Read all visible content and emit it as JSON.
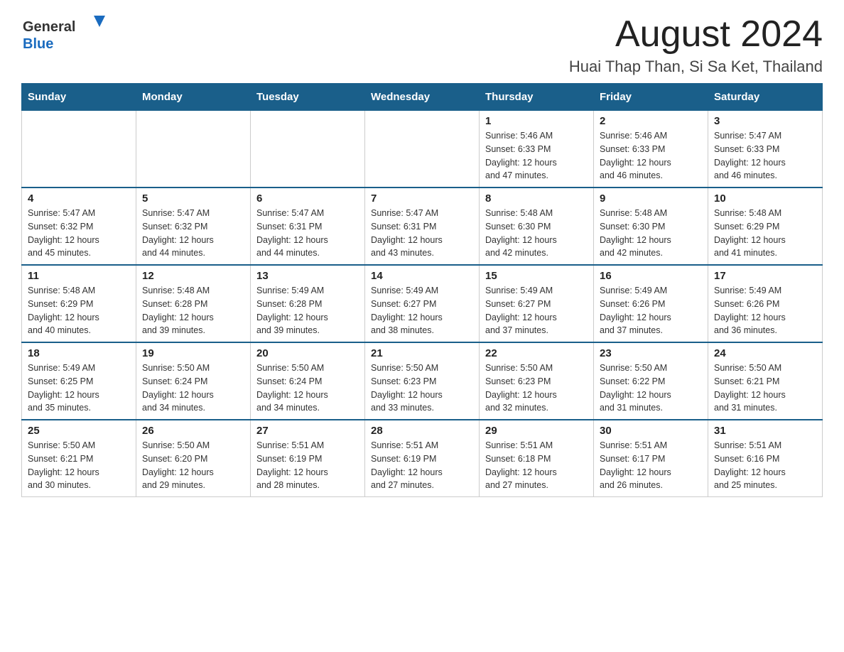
{
  "header": {
    "logo_general": "General",
    "logo_blue": "Blue",
    "title": "August 2024",
    "subtitle": "Huai Thap Than, Si Sa Ket, Thailand"
  },
  "days_of_week": [
    "Sunday",
    "Monday",
    "Tuesday",
    "Wednesday",
    "Thursday",
    "Friday",
    "Saturday"
  ],
  "weeks": [
    {
      "days": [
        {
          "number": "",
          "info": ""
        },
        {
          "number": "",
          "info": ""
        },
        {
          "number": "",
          "info": ""
        },
        {
          "number": "",
          "info": ""
        },
        {
          "number": "1",
          "info": "Sunrise: 5:46 AM\nSunset: 6:33 PM\nDaylight: 12 hours\nand 47 minutes."
        },
        {
          "number": "2",
          "info": "Sunrise: 5:46 AM\nSunset: 6:33 PM\nDaylight: 12 hours\nand 46 minutes."
        },
        {
          "number": "3",
          "info": "Sunrise: 5:47 AM\nSunset: 6:33 PM\nDaylight: 12 hours\nand 46 minutes."
        }
      ]
    },
    {
      "days": [
        {
          "number": "4",
          "info": "Sunrise: 5:47 AM\nSunset: 6:32 PM\nDaylight: 12 hours\nand 45 minutes."
        },
        {
          "number": "5",
          "info": "Sunrise: 5:47 AM\nSunset: 6:32 PM\nDaylight: 12 hours\nand 44 minutes."
        },
        {
          "number": "6",
          "info": "Sunrise: 5:47 AM\nSunset: 6:31 PM\nDaylight: 12 hours\nand 44 minutes."
        },
        {
          "number": "7",
          "info": "Sunrise: 5:47 AM\nSunset: 6:31 PM\nDaylight: 12 hours\nand 43 minutes."
        },
        {
          "number": "8",
          "info": "Sunrise: 5:48 AM\nSunset: 6:30 PM\nDaylight: 12 hours\nand 42 minutes."
        },
        {
          "number": "9",
          "info": "Sunrise: 5:48 AM\nSunset: 6:30 PM\nDaylight: 12 hours\nand 42 minutes."
        },
        {
          "number": "10",
          "info": "Sunrise: 5:48 AM\nSunset: 6:29 PM\nDaylight: 12 hours\nand 41 minutes."
        }
      ]
    },
    {
      "days": [
        {
          "number": "11",
          "info": "Sunrise: 5:48 AM\nSunset: 6:29 PM\nDaylight: 12 hours\nand 40 minutes."
        },
        {
          "number": "12",
          "info": "Sunrise: 5:48 AM\nSunset: 6:28 PM\nDaylight: 12 hours\nand 39 minutes."
        },
        {
          "number": "13",
          "info": "Sunrise: 5:49 AM\nSunset: 6:28 PM\nDaylight: 12 hours\nand 39 minutes."
        },
        {
          "number": "14",
          "info": "Sunrise: 5:49 AM\nSunset: 6:27 PM\nDaylight: 12 hours\nand 38 minutes."
        },
        {
          "number": "15",
          "info": "Sunrise: 5:49 AM\nSunset: 6:27 PM\nDaylight: 12 hours\nand 37 minutes."
        },
        {
          "number": "16",
          "info": "Sunrise: 5:49 AM\nSunset: 6:26 PM\nDaylight: 12 hours\nand 37 minutes."
        },
        {
          "number": "17",
          "info": "Sunrise: 5:49 AM\nSunset: 6:26 PM\nDaylight: 12 hours\nand 36 minutes."
        }
      ]
    },
    {
      "days": [
        {
          "number": "18",
          "info": "Sunrise: 5:49 AM\nSunset: 6:25 PM\nDaylight: 12 hours\nand 35 minutes."
        },
        {
          "number": "19",
          "info": "Sunrise: 5:50 AM\nSunset: 6:24 PM\nDaylight: 12 hours\nand 34 minutes."
        },
        {
          "number": "20",
          "info": "Sunrise: 5:50 AM\nSunset: 6:24 PM\nDaylight: 12 hours\nand 34 minutes."
        },
        {
          "number": "21",
          "info": "Sunrise: 5:50 AM\nSunset: 6:23 PM\nDaylight: 12 hours\nand 33 minutes."
        },
        {
          "number": "22",
          "info": "Sunrise: 5:50 AM\nSunset: 6:23 PM\nDaylight: 12 hours\nand 32 minutes."
        },
        {
          "number": "23",
          "info": "Sunrise: 5:50 AM\nSunset: 6:22 PM\nDaylight: 12 hours\nand 31 minutes."
        },
        {
          "number": "24",
          "info": "Sunrise: 5:50 AM\nSunset: 6:21 PM\nDaylight: 12 hours\nand 31 minutes."
        }
      ]
    },
    {
      "days": [
        {
          "number": "25",
          "info": "Sunrise: 5:50 AM\nSunset: 6:21 PM\nDaylight: 12 hours\nand 30 minutes."
        },
        {
          "number": "26",
          "info": "Sunrise: 5:50 AM\nSunset: 6:20 PM\nDaylight: 12 hours\nand 29 minutes."
        },
        {
          "number": "27",
          "info": "Sunrise: 5:51 AM\nSunset: 6:19 PM\nDaylight: 12 hours\nand 28 minutes."
        },
        {
          "number": "28",
          "info": "Sunrise: 5:51 AM\nSunset: 6:19 PM\nDaylight: 12 hours\nand 27 minutes."
        },
        {
          "number": "29",
          "info": "Sunrise: 5:51 AM\nSunset: 6:18 PM\nDaylight: 12 hours\nand 27 minutes."
        },
        {
          "number": "30",
          "info": "Sunrise: 5:51 AM\nSunset: 6:17 PM\nDaylight: 12 hours\nand 26 minutes."
        },
        {
          "number": "31",
          "info": "Sunrise: 5:51 AM\nSunset: 6:16 PM\nDaylight: 12 hours\nand 25 minutes."
        }
      ]
    }
  ]
}
